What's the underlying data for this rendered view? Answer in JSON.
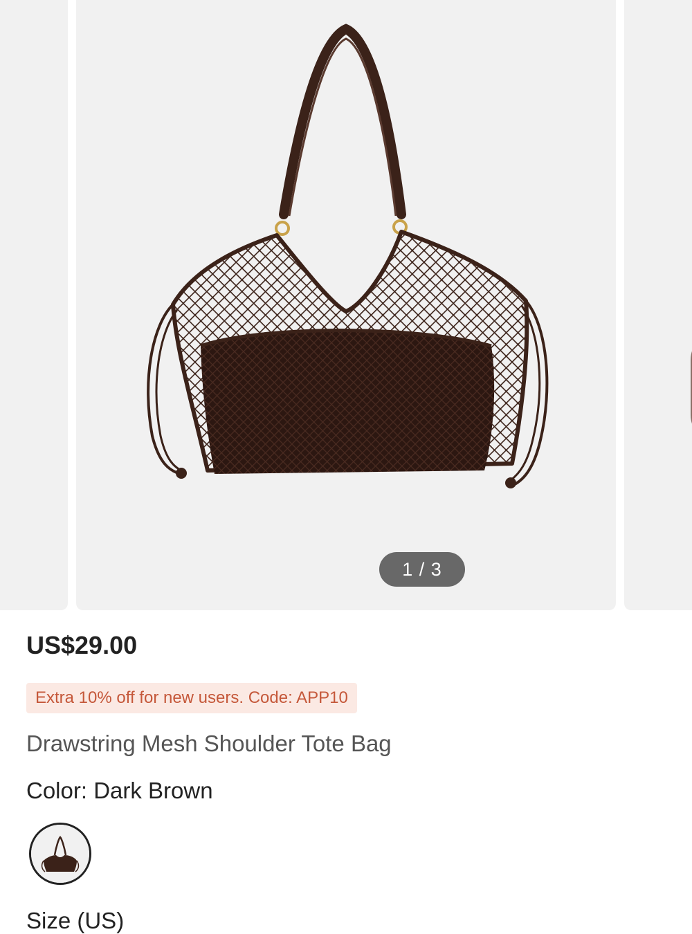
{
  "gallery": {
    "current_page": 1,
    "total_pages": 3,
    "indicator": "1 / 3",
    "image_icon": "mesh-tote-bag-image"
  },
  "product": {
    "price": "US$29.00",
    "promo": "Extra 10% off for new users. Code: APP10",
    "title": "Drawstring Mesh Shoulder Tote Bag"
  },
  "color": {
    "label": "Color: Dark Brown",
    "swatch_color": "#3b2219"
  },
  "size": {
    "label": "Size (US)"
  },
  "colors": {
    "promo_bg": "#fbe9e3",
    "promo_text": "#c5583a",
    "bag_brown": "#3b2219"
  }
}
